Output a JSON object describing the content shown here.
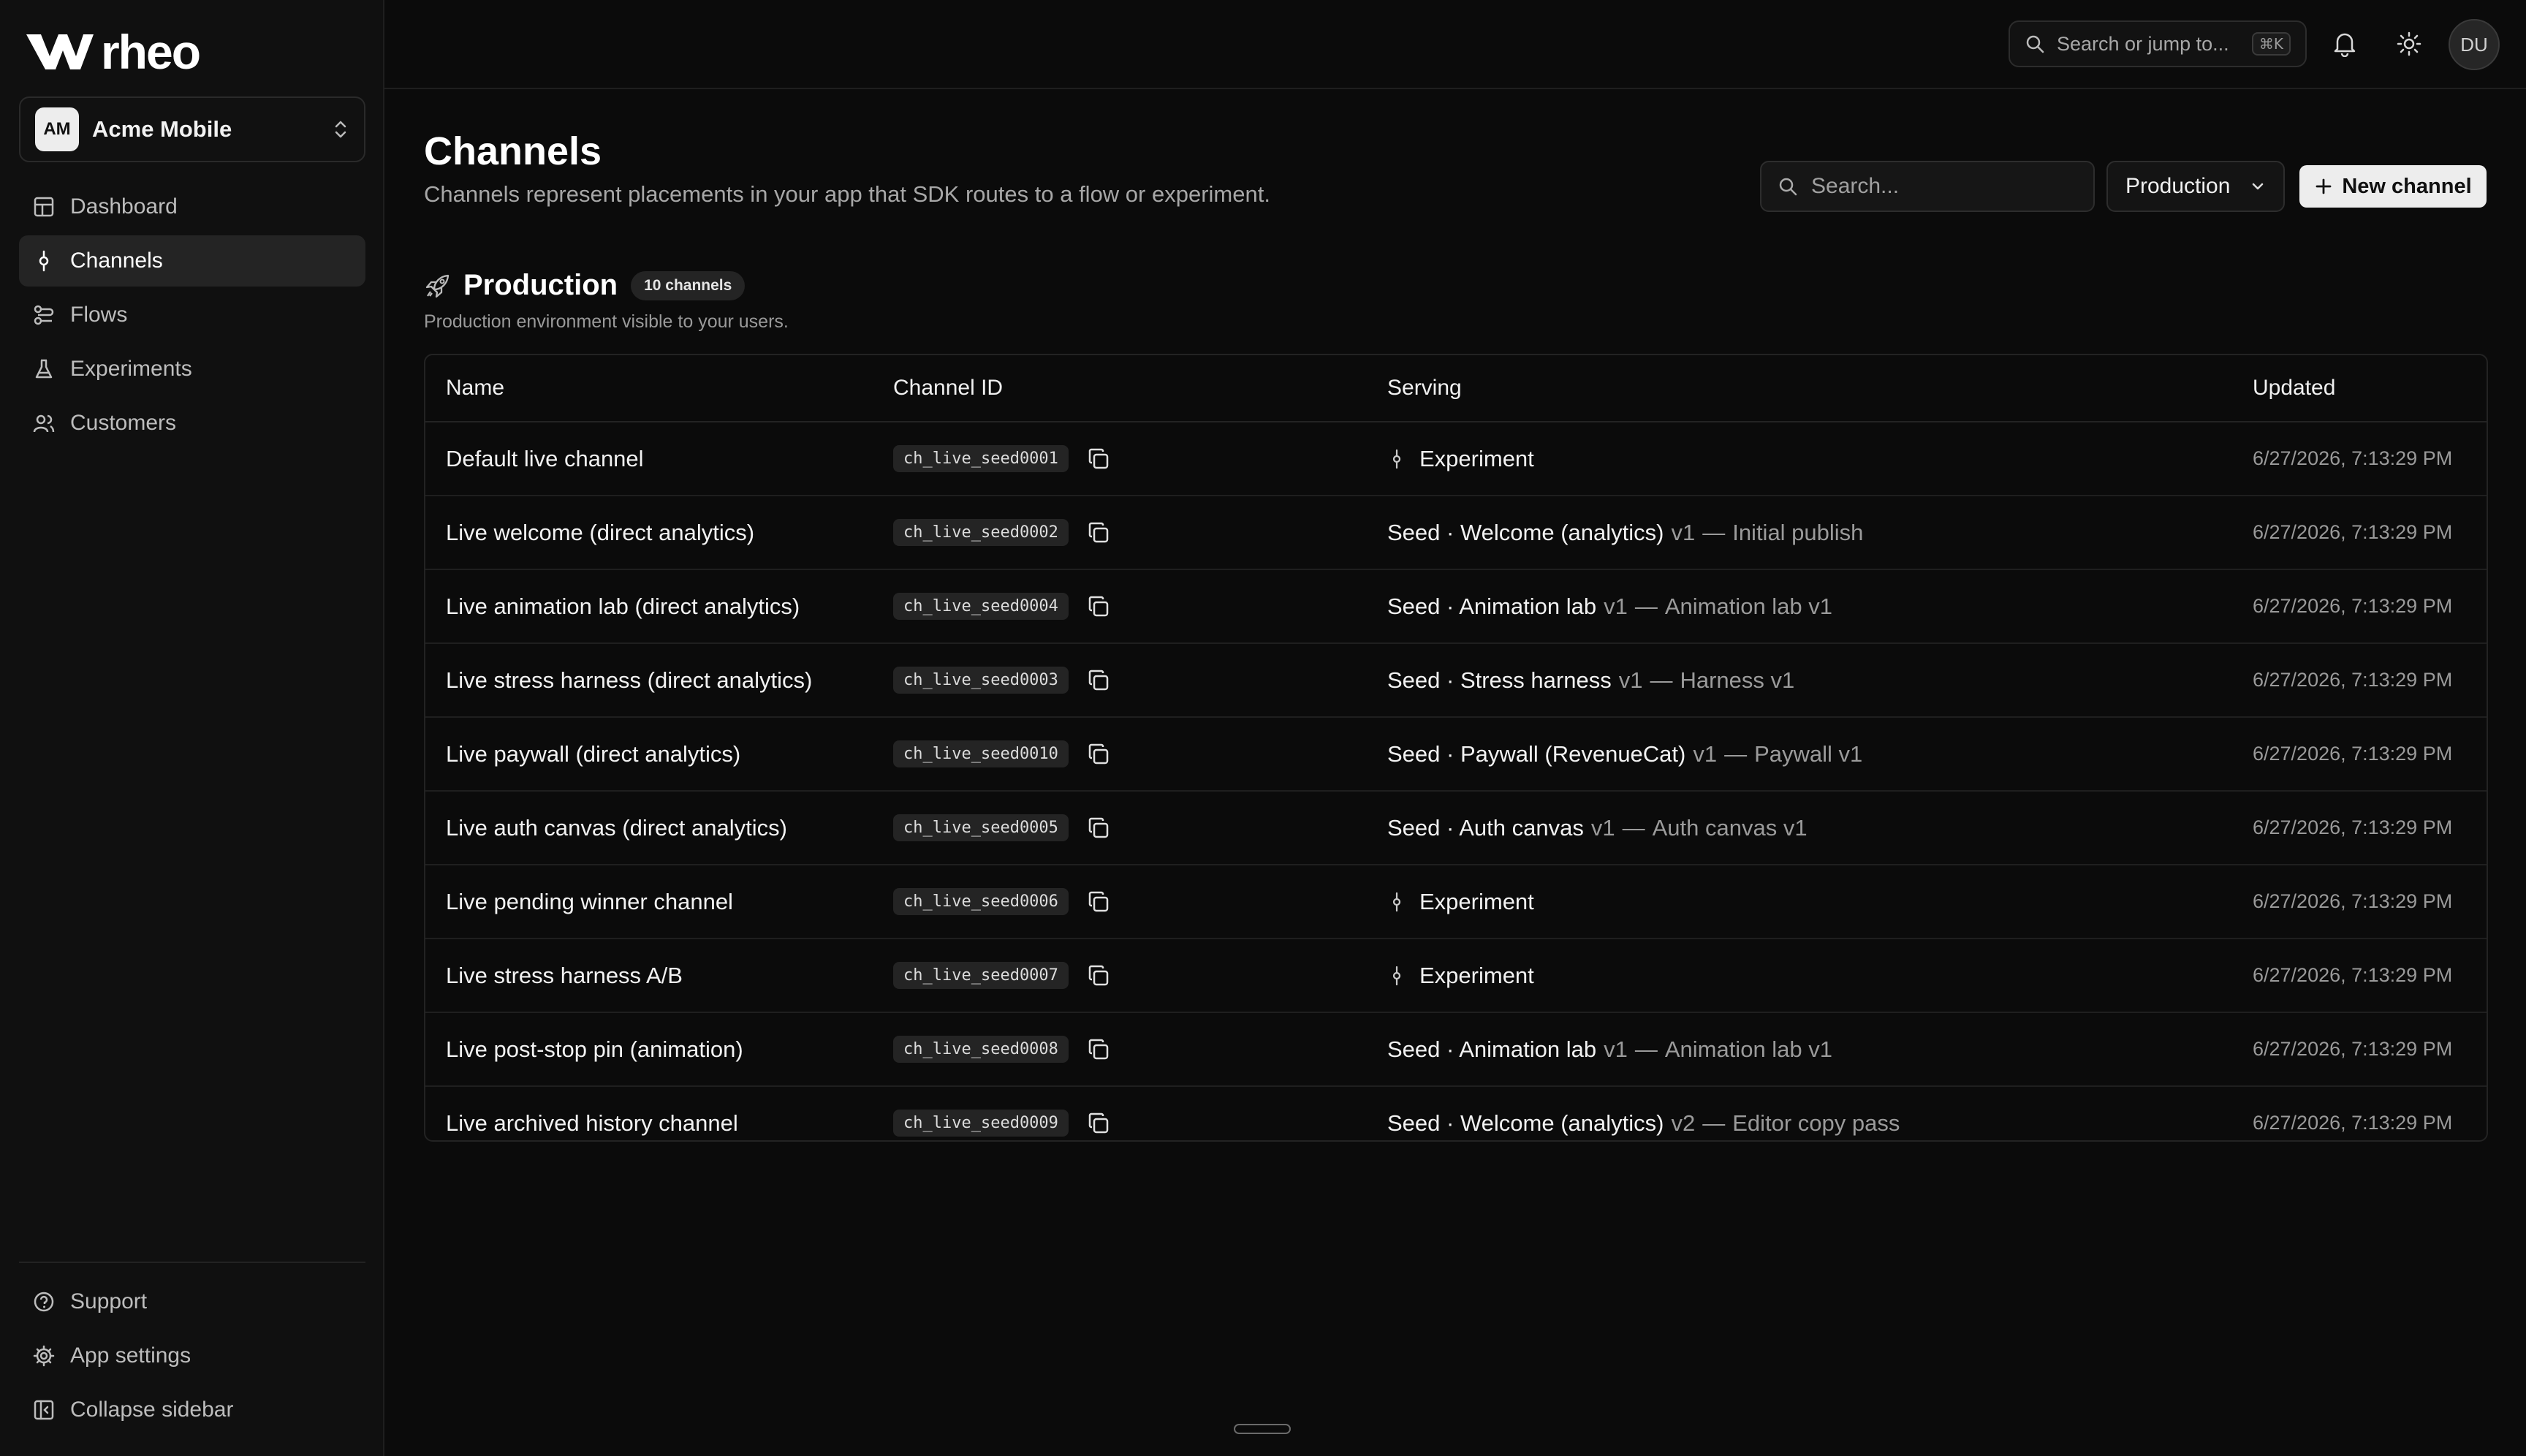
{
  "brand": {
    "name": "rheo"
  },
  "org": {
    "initials": "AM",
    "name": "Acme Mobile"
  },
  "nav": [
    {
      "label": "Dashboard",
      "icon": "dashboard-icon",
      "active": false
    },
    {
      "label": "Channels",
      "icon": "channels-icon",
      "active": true
    },
    {
      "label": "Flows",
      "icon": "flows-icon",
      "active": false
    },
    {
      "label": "Experiments",
      "icon": "flask-icon",
      "active": false
    },
    {
      "label": "Customers",
      "icon": "users-icon",
      "active": false
    }
  ],
  "nav_bottom": [
    {
      "label": "Support",
      "icon": "help-icon"
    },
    {
      "label": "App settings",
      "icon": "gear-icon"
    },
    {
      "label": "Collapse sidebar",
      "icon": "sidebar-collapse-icon"
    }
  ],
  "topbar": {
    "search_label": "Search or jump to...",
    "shortcut": "⌘K",
    "user_initials": "DU"
  },
  "page": {
    "title": "Channels",
    "subtitle": "Channels represent placements in your app that SDK routes to a flow or experiment.",
    "search_placeholder": "Search...",
    "environment": "Production",
    "new_button": "New channel"
  },
  "section": {
    "title": "Production",
    "count": "10 channels",
    "description": "Production environment visible to your users."
  },
  "table": {
    "headers": {
      "name": "Name",
      "id": "Channel ID",
      "serving": "Serving",
      "updated": "Updated"
    },
    "rows": [
      {
        "name": "Default live channel",
        "id": "ch_live_seed0001",
        "serving_type": "experiment",
        "serving_label": "Experiment",
        "serving_main": "",
        "serving_version": "",
        "serving_detail": "",
        "updated": "6/27/2026, 7:13:29 PM"
      },
      {
        "name": "Live welcome (direct analytics)",
        "id": "ch_live_seed0002",
        "serving_type": "flow",
        "serving_label": "",
        "serving_main": "Seed · Welcome (analytics)",
        "serving_version": "v1",
        "serving_detail": "Initial publish",
        "updated": "6/27/2026, 7:13:29 PM"
      },
      {
        "name": "Live animation lab (direct analytics)",
        "id": "ch_live_seed0004",
        "serving_type": "flow",
        "serving_label": "",
        "serving_main": "Seed · Animation lab",
        "serving_version": "v1",
        "serving_detail": "Animation lab v1",
        "updated": "6/27/2026, 7:13:29 PM"
      },
      {
        "name": "Live stress harness (direct analytics)",
        "id": "ch_live_seed0003",
        "serving_type": "flow",
        "serving_label": "",
        "serving_main": "Seed · Stress harness",
        "serving_version": "v1",
        "serving_detail": "Harness v1",
        "updated": "6/27/2026, 7:13:29 PM"
      },
      {
        "name": "Live paywall (direct analytics)",
        "id": "ch_live_seed0010",
        "serving_type": "flow",
        "serving_label": "",
        "serving_main": "Seed · Paywall (RevenueCat)",
        "serving_version": "v1",
        "serving_detail": "Paywall v1",
        "updated": "6/27/2026, 7:13:29 PM"
      },
      {
        "name": "Live auth canvas (direct analytics)",
        "id": "ch_live_seed0005",
        "serving_type": "flow",
        "serving_label": "",
        "serving_main": "Seed · Auth canvas",
        "serving_version": "v1",
        "serving_detail": "Auth canvas v1",
        "updated": "6/27/2026, 7:13:29 PM"
      },
      {
        "name": "Live pending winner channel",
        "id": "ch_live_seed0006",
        "serving_type": "experiment",
        "serving_label": "Experiment",
        "serving_main": "",
        "serving_version": "",
        "serving_detail": "",
        "updated": "6/27/2026, 7:13:29 PM"
      },
      {
        "name": "Live stress harness A/B",
        "id": "ch_live_seed0007",
        "serving_type": "experiment",
        "serving_label": "Experiment",
        "serving_main": "",
        "serving_version": "",
        "serving_detail": "",
        "updated": "6/27/2026, 7:13:29 PM"
      },
      {
        "name": "Live post-stop pin (animation)",
        "id": "ch_live_seed0008",
        "serving_type": "flow",
        "serving_label": "",
        "serving_main": "Seed · Animation lab",
        "serving_version": "v1",
        "serving_detail": "Animation lab v1",
        "updated": "6/27/2026, 7:13:29 PM"
      },
      {
        "name": "Live archived history channel",
        "id": "ch_live_seed0009",
        "serving_type": "flow",
        "serving_label": "",
        "serving_main": "Seed · Welcome (analytics)",
        "serving_version": "v2",
        "serving_detail": "Editor copy pass",
        "updated": "6/27/2026, 7:13:29 PM"
      }
    ]
  },
  "colors": {
    "background": "#0b0b0b",
    "sidebar": "#101010",
    "active_nav": "#242424",
    "muted_text": "#9a9a9a",
    "primary_button": "#ededed"
  }
}
